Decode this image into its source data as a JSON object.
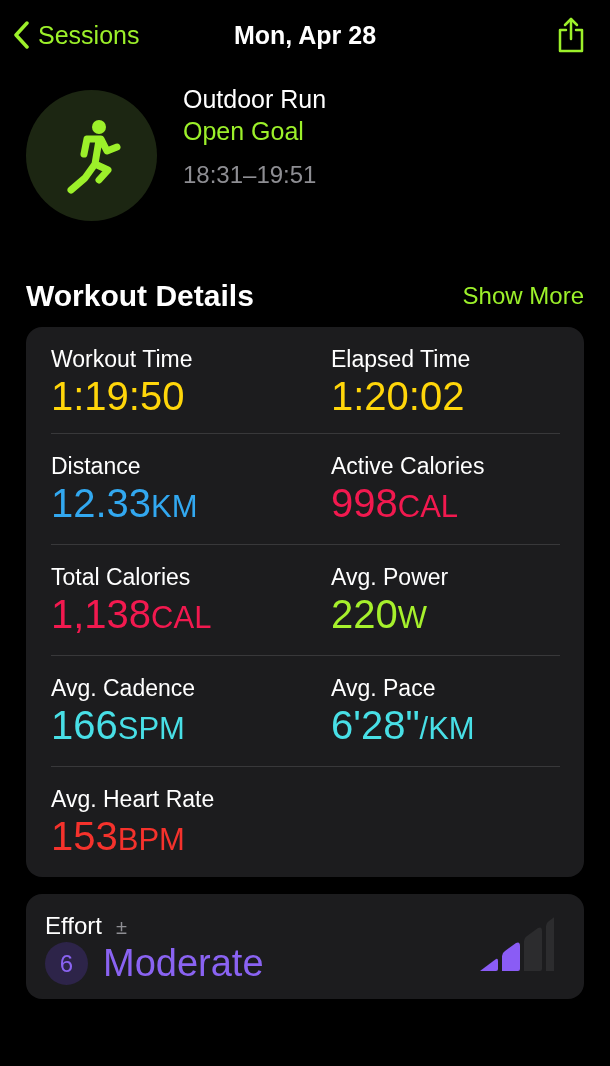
{
  "nav": {
    "back": "Sessions",
    "title": "Mon, Apr 28"
  },
  "workout": {
    "name": "Outdoor Run",
    "goal": "Open Goal",
    "time_range": "18:31–19:51"
  },
  "details": {
    "title": "Workout Details",
    "action": "Show More",
    "metrics": [
      {
        "label": "Workout Time",
        "value": "1:19:50",
        "color": "#ffd60a"
      },
      {
        "label": "Elapsed Time",
        "value": "1:20:02",
        "color": "#ffd60a"
      },
      {
        "label": "Distance",
        "value": "12.33",
        "unit": "KM",
        "color": "#32a8f0"
      },
      {
        "label": "Active Calories",
        "value": "998",
        "unit": "CAL",
        "color": "#f2194f"
      },
      {
        "label": "Total Calories",
        "value": "1,138",
        "unit": "CAL",
        "color": "#f2194f"
      },
      {
        "label": "Avg. Power",
        "value": "220",
        "unit": "W",
        "color": "#a6f02c"
      },
      {
        "label": "Avg. Cadence",
        "value": "166",
        "unit": "SPM",
        "color": "#48dfe6"
      },
      {
        "label": "Avg. Pace",
        "value": "6'28\"",
        "unit": "/KM",
        "color": "#48dfe6"
      },
      {
        "label": "Avg. Heart Rate",
        "value": "153",
        "unit": "BPM",
        "color": "#f5322c"
      }
    ]
  },
  "effort": {
    "label": "Effort",
    "adjust": "±",
    "score": "6",
    "rating": "Moderate",
    "level": 0.5
  }
}
